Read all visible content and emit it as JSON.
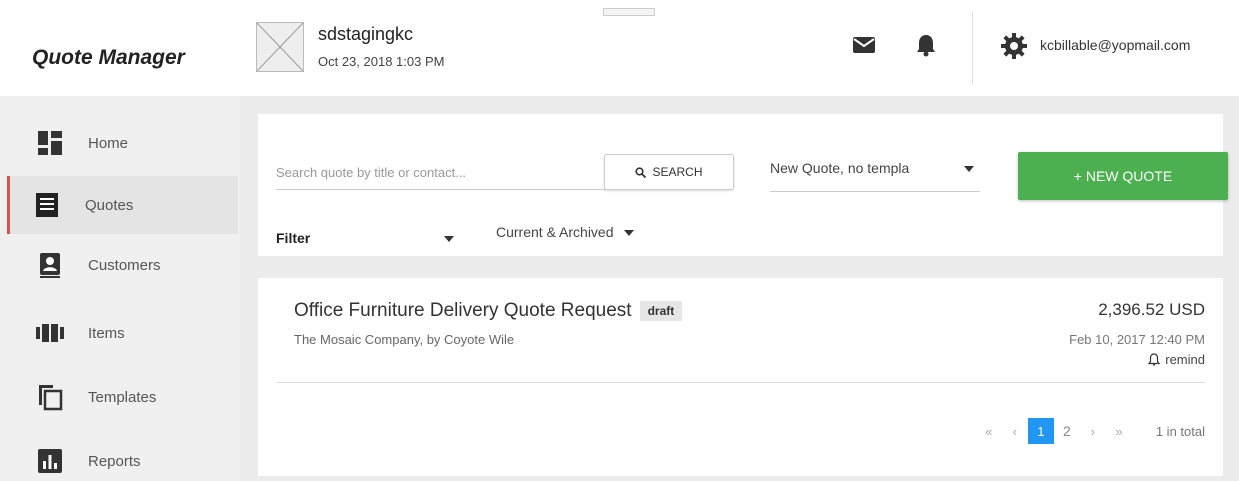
{
  "header": {
    "brand": "Quote Manager",
    "org_name": "sdstagingkc",
    "org_date": "Oct 23, 2018 1:03 PM",
    "mail_icon": "mail-icon",
    "bell_icon": "bell-icon",
    "settings_icon": "gear-icon",
    "user_email": "kcbillable@yopmail.com"
  },
  "sidebar": {
    "items": [
      {
        "label": "Home",
        "icon": "home-grid-icon"
      },
      {
        "label": "Quotes",
        "icon": "quotes-list-icon",
        "active": true
      },
      {
        "label": "Customers",
        "icon": "customers-icon"
      },
      {
        "label": "Items",
        "icon": "items-icon"
      },
      {
        "label": "Templates",
        "icon": "templates-icon"
      },
      {
        "label": "Reports",
        "icon": "reports-icon"
      }
    ]
  },
  "search": {
    "placeholder": "Search quote by title or contact...",
    "button_label": "SEARCH"
  },
  "template_select": {
    "value": "New Quote, no templa"
  },
  "new_quote_button": "+ NEW QUOTE",
  "filter": {
    "label": "Filter",
    "archive_value": "Current & Archived"
  },
  "quote": {
    "title": "Office Furniture Delivery Quote Request",
    "badge": "draft",
    "subtitle": "The Mosaic Company, by Coyote Wile",
    "amount": "2,396.52 USD",
    "date": "Feb 10, 2017 12:40 PM",
    "remind": "remind"
  },
  "pagination": {
    "first": "«",
    "prev": "‹",
    "pages": [
      "1",
      "2"
    ],
    "current": "1",
    "next": "›",
    "last": "»",
    "total": "1 in total"
  },
  "colors": {
    "accent_green": "#4caf50",
    "active_page": "#2196f3",
    "active_marker": "#d9534f"
  }
}
